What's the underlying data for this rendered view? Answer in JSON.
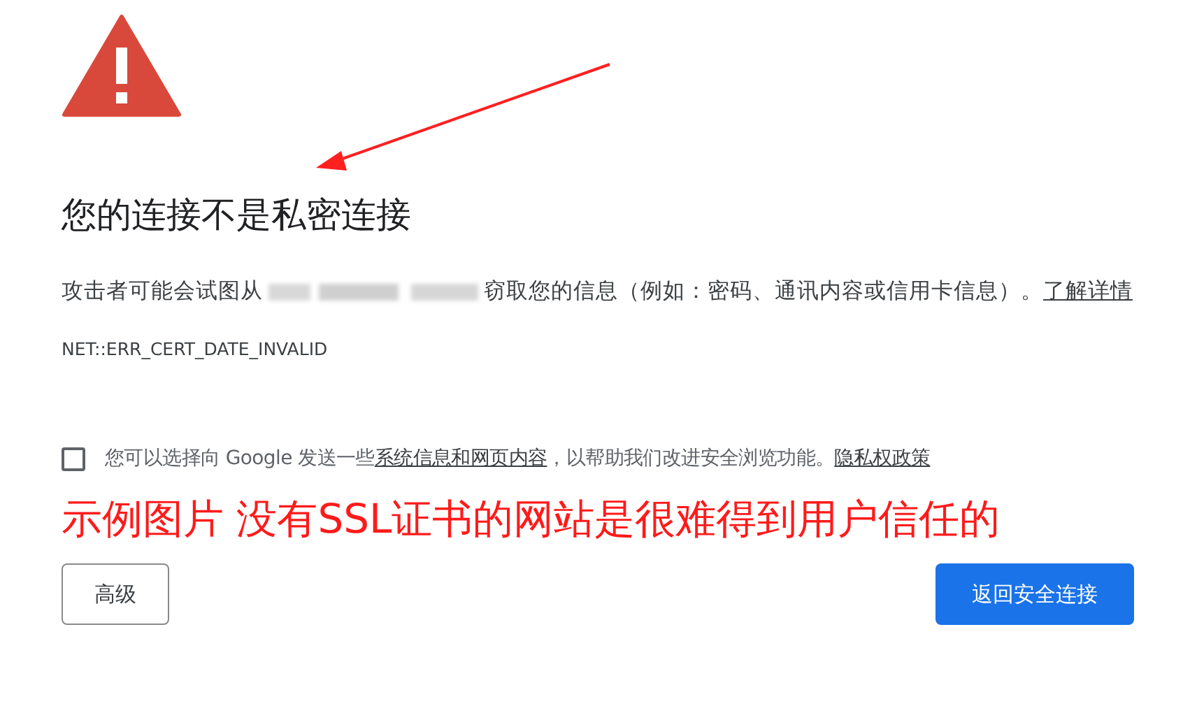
{
  "heading": "您的连接不是私密连接",
  "message": {
    "before": "攻击者可能会试图从",
    "after": "窃取您的信息（例如：密码、通讯内容或信用卡信息）。",
    "link": "了解详情"
  },
  "error_code": "NET::ERR_CERT_DATE_INVALID",
  "opt_in": {
    "checked": false,
    "before": "您可以选择向 Google 发送一些",
    "link": "系统信息和网页内容",
    "after": "，以帮助我们改进安全浏览功能。",
    "policy_link": "隐私权政策"
  },
  "caption": "示例图片 没有SSL证书的网站是很难得到用户信任的",
  "buttons": [
    {
      "label": "高级",
      "kind": "secondary"
    },
    {
      "label": "返回安全连接",
      "kind": "primary"
    }
  ]
}
